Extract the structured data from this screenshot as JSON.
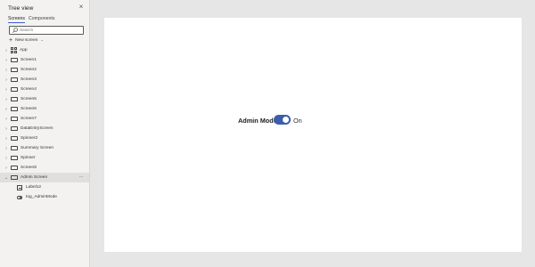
{
  "panel": {
    "title": "Tree view",
    "close_icon": "close-icon",
    "tabs": [
      {
        "label": "Screens",
        "active": true
      },
      {
        "label": "Components",
        "active": false
      }
    ],
    "search": {
      "placeholder": "Search",
      "value": ""
    },
    "new_screen_label": "New screen"
  },
  "tree": {
    "items": [
      {
        "label": "App",
        "icon": "app-icon"
      },
      {
        "label": "Screen1",
        "icon": "screen-icon"
      },
      {
        "label": "Screen2",
        "icon": "screen-icon"
      },
      {
        "label": "Screen3",
        "icon": "screen-icon"
      },
      {
        "label": "Screen4",
        "icon": "screen-icon"
      },
      {
        "label": "Screen5",
        "icon": "screen-icon"
      },
      {
        "label": "Screen6",
        "icon": "screen-icon"
      },
      {
        "label": "Screen7",
        "icon": "screen-icon"
      },
      {
        "label": "DataEntryScreen",
        "icon": "screen-icon"
      },
      {
        "label": "Spinner2",
        "icon": "screen-icon"
      },
      {
        "label": "Summary Screen",
        "icon": "screen-icon"
      },
      {
        "label": "Spinner",
        "icon": "screen-icon"
      },
      {
        "label": "Screen8",
        "icon": "screen-icon"
      },
      {
        "label": "Admin Screen",
        "icon": "screen-icon",
        "selected": true
      }
    ],
    "children": [
      {
        "label": "Label12",
        "icon": "label-icon"
      },
      {
        "label": "tog_AdminMode",
        "icon": "toggle-icon"
      }
    ],
    "more_label": "···"
  },
  "canvas": {
    "admin_label": "Admin Mode",
    "toggle_on": true,
    "toggle_state_label": "On",
    "accent_color": "#3a5fa8"
  }
}
